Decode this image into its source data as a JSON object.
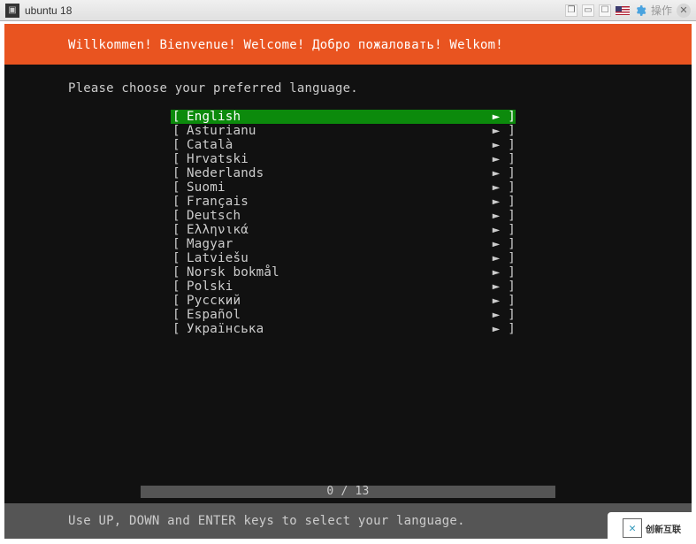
{
  "titlebar": {
    "title": "ubuntu 18",
    "ops_label": "操作"
  },
  "installer": {
    "header": "Willkommen! Bienvenue! Welcome! Добро пожаловать! Welkom!",
    "prompt": "Please choose your preferred language.",
    "languages": [
      {
        "name": "English",
        "selected": true
      },
      {
        "name": "Asturianu",
        "selected": false
      },
      {
        "name": "Català",
        "selected": false
      },
      {
        "name": "Hrvatski",
        "selected": false
      },
      {
        "name": "Nederlands",
        "selected": false
      },
      {
        "name": "Suomi",
        "selected": false
      },
      {
        "name": "Français",
        "selected": false
      },
      {
        "name": "Deutsch",
        "selected": false
      },
      {
        "name": "Ελληνικά",
        "selected": false
      },
      {
        "name": "Magyar",
        "selected": false
      },
      {
        "name": "Latviešu",
        "selected": false
      },
      {
        "name": "Norsk bokmål",
        "selected": false
      },
      {
        "name": "Polski",
        "selected": false
      },
      {
        "name": "Русский",
        "selected": false
      },
      {
        "name": "Español",
        "selected": false
      },
      {
        "name": "Українська",
        "selected": false
      }
    ],
    "progress": "0 / 13",
    "footer": "Use UP, DOWN and ENTER keys to select your language."
  },
  "watermark": "创新互联"
}
